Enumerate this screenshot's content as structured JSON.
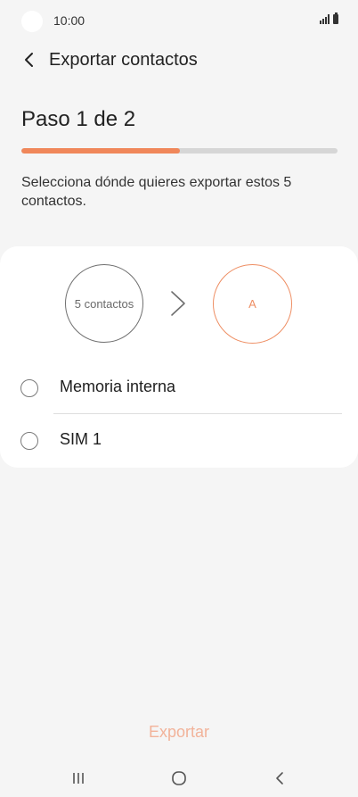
{
  "status_bar": {
    "time": "10:00"
  },
  "header": {
    "title": "Exportar contactos"
  },
  "step": {
    "title": "Paso 1 de 2",
    "progress": 0.5
  },
  "instruction": "Selecciona dónde quieres exportar estos 5 contactos.",
  "export_card": {
    "source_label": "5 contactos",
    "destination_label": "A",
    "options": [
      {
        "label": "Memoria interna",
        "selected": false
      },
      {
        "label": "SIM 1",
        "selected": false
      }
    ]
  },
  "actions": {
    "export_label": "Exportar"
  },
  "colors": {
    "accent": "#f0875a",
    "accent_light": "#f2b39a",
    "background": "#f5f5f5"
  },
  "nav_bar": {
    "icons": [
      "recent-apps-icon",
      "home-icon",
      "back-icon"
    ]
  }
}
